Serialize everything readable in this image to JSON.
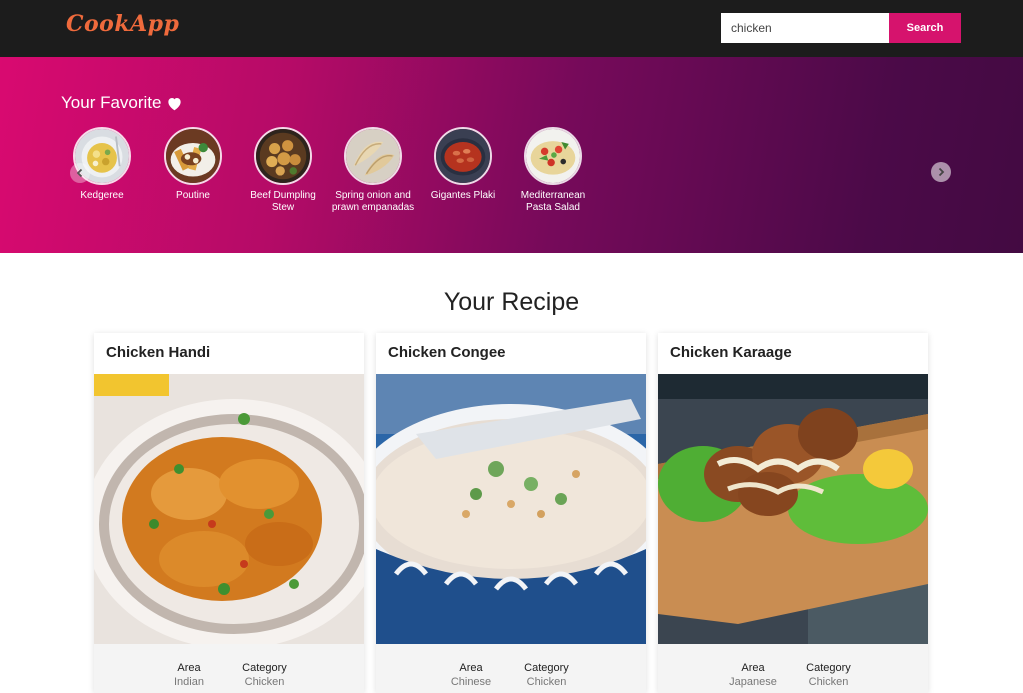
{
  "app": {
    "logo": "CookApp"
  },
  "search": {
    "value": "chicken",
    "button_label": "Search"
  },
  "favorites": {
    "title": "Your Favorite",
    "items": [
      {
        "name": "Kedgeree"
      },
      {
        "name": "Poutine"
      },
      {
        "name": "Beef Dumpling Stew"
      },
      {
        "name": "Spring onion and prawn empanadas"
      },
      {
        "name": "Gigantes Plaki"
      },
      {
        "name": "Mediterranean Pasta Salad"
      }
    ]
  },
  "recipes": {
    "title": "Your Recipe",
    "area_label": "Area",
    "category_label": "Category",
    "items": [
      {
        "name": "Chicken Handi",
        "area": "Indian",
        "category": "Chicken"
      },
      {
        "name": "Chicken Congee",
        "area": "Chinese",
        "category": "Chicken"
      },
      {
        "name": "Chicken Karaage",
        "area": "Japanese",
        "category": "Chicken"
      }
    ]
  },
  "colors": {
    "accent": "#d6136d",
    "logo": "#ef6a3c",
    "topbar": "#1c1c1c"
  }
}
